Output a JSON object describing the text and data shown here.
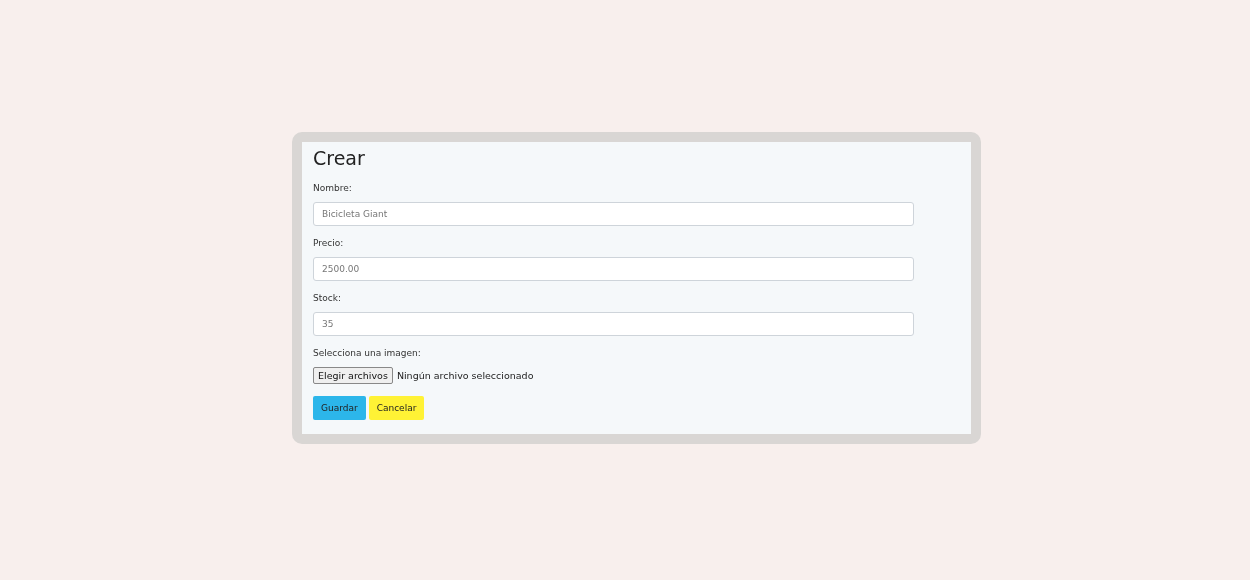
{
  "form": {
    "title": "Crear",
    "fields": [
      {
        "label": "Nombre:",
        "placeholder": "Bicicleta Giant"
      },
      {
        "label": "Precio:",
        "placeholder": "2500.00"
      },
      {
        "label": "Stock:",
        "placeholder": "35"
      }
    ],
    "file_input": {
      "label": "Selecciona una imagen:",
      "button": "Elegir archivos",
      "status": "Ningún archivo seleccionado"
    },
    "buttons": [
      {
        "label": "Guardar",
        "kind": "primary"
      },
      {
        "label": "Cancelar",
        "kind": "warning"
      }
    ]
  }
}
